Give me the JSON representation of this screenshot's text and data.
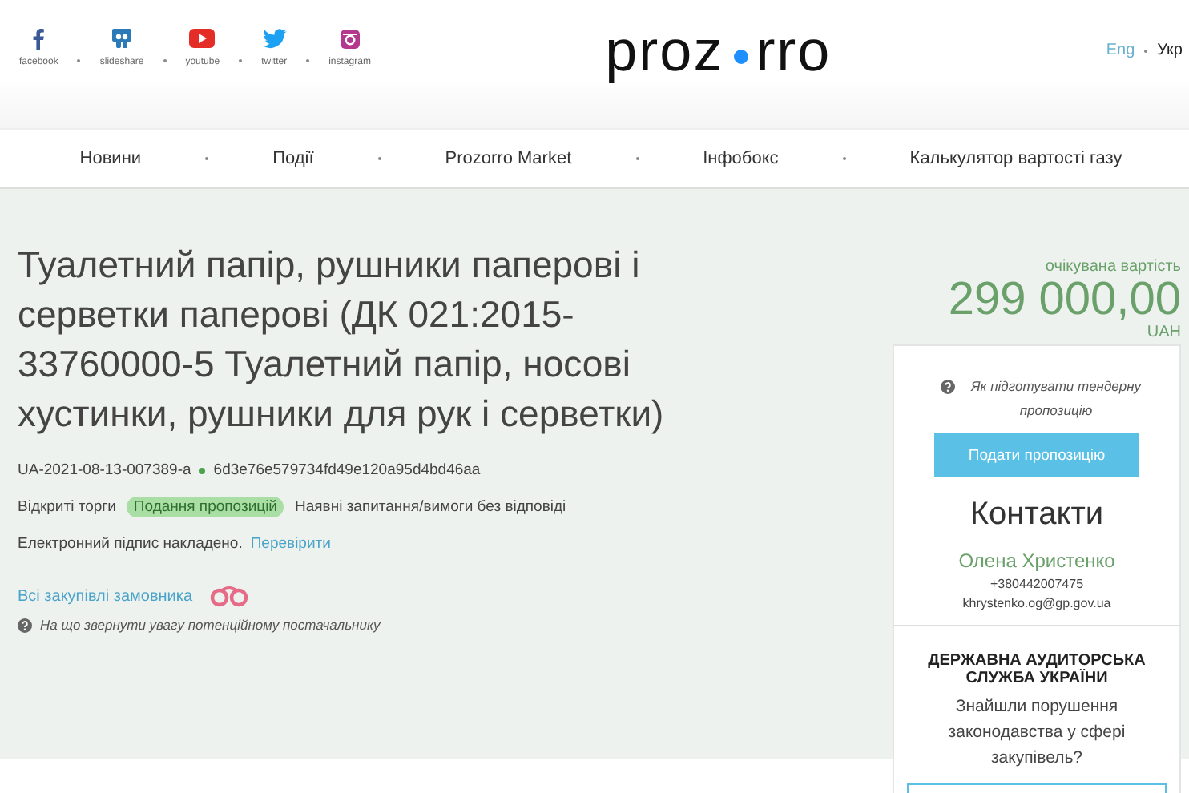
{
  "social": [
    {
      "kind": "facebook",
      "label": "facebook"
    },
    {
      "kind": "slideshare",
      "label": "slideshare"
    },
    {
      "kind": "youtube",
      "label": "youtube"
    },
    {
      "kind": "twitter",
      "label": "twitter"
    },
    {
      "kind": "instagram",
      "label": "instagram"
    }
  ],
  "logo": {
    "left": "proz",
    "right": "rro"
  },
  "languages": [
    {
      "label": "Eng",
      "selected": false
    },
    {
      "label": "Укр",
      "selected": true
    }
  ],
  "nav": [
    "Новини",
    "Події",
    "Prozorro Market",
    "Інфобокс",
    "Калькулятор вартості газу"
  ],
  "tender": {
    "title": "Туалетний папір, рушники паперові і серветки паперові (ДК 021:2015-33760000-5 Туалетний папір, носові хустинки, рушники для рук і серветки)",
    "id": "UA-2021-08-13-007389-a",
    "hash": "6d3e76e579734fd49e120a95d4bd46aa",
    "procedure": "Відкриті торги",
    "status": "Подання пропозицій",
    "questions": "Наявні запитання/вимоги без відповіді",
    "signature": "Електронний підпис накладено.",
    "verify_link": "Перевірити",
    "all_purchases_link": "Всі закупівлі замовника",
    "hint": "На що звернути увагу потенційному постачальнику"
  },
  "price": {
    "label": "очікувана вартість",
    "amount": "299 000,00",
    "currency": "UAH"
  },
  "sidebar": {
    "guide_link": "Як підготувати тендерну пропозицію",
    "submit_button": "Подати пропозицію",
    "contacts_title": "Контакти",
    "contact_name": "Олена Христенко",
    "phone": "+380442007475",
    "email": "khrystenko.og@gp.gov.ua",
    "audit_title": "ДЕРЖАВНА АУДИТОРСЬКА СЛУЖБА УКРАЇНИ",
    "audit_text": "Знайшли порушення законодавства у сфері закупівель?"
  }
}
